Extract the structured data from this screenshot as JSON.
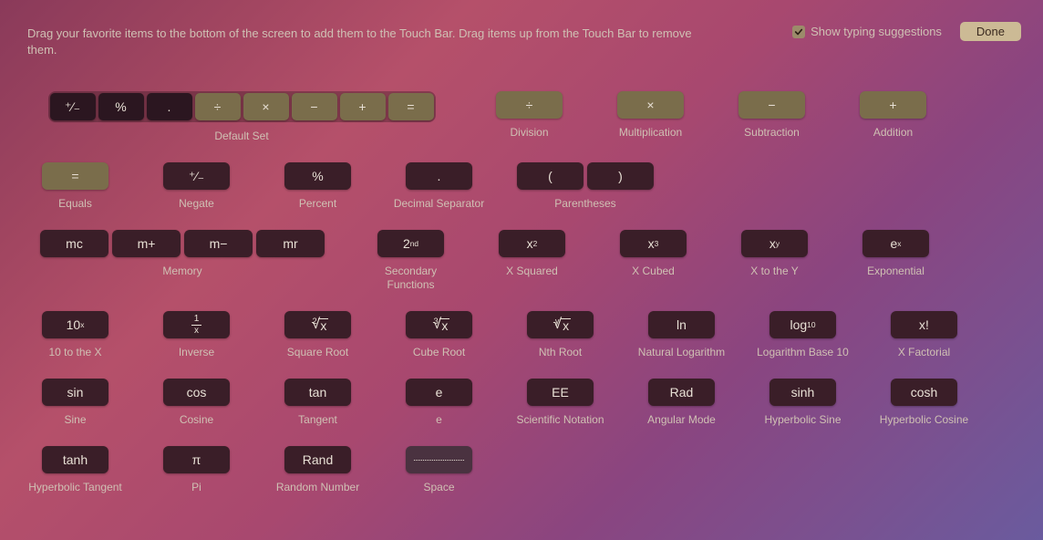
{
  "header": {
    "instructions": "Drag your favorite items to the bottom of the screen to add them to the Touch Bar. Drag items up from the Touch Bar to remove them.",
    "checkbox_label": "Show typing suggestions",
    "done_label": "Done"
  },
  "defaultSet": {
    "label": "Default Set",
    "keys": [
      "⁺⁄₋",
      "%",
      ".",
      "÷",
      "×",
      "−",
      "+",
      "="
    ]
  },
  "row1": {
    "division": {
      "glyph": "÷",
      "label": "Division"
    },
    "multiplication": {
      "glyph": "×",
      "label": "Multiplication"
    },
    "subtraction": {
      "glyph": "−",
      "label": "Subtraction"
    },
    "addition": {
      "glyph": "+",
      "label": "Addition"
    }
  },
  "row2": {
    "equals": {
      "glyph": "=",
      "label": "Equals"
    },
    "negate": {
      "glyph": "⁺⁄₋",
      "label": "Negate"
    },
    "percent": {
      "glyph": "%",
      "label": "Percent"
    },
    "decimal": {
      "glyph": ".",
      "label": "Decimal Separator"
    },
    "parens": {
      "open": "(",
      "close": ")",
      "label": "Parentheses"
    }
  },
  "row3": {
    "memory": {
      "keys": [
        "mc",
        "m+",
        "m−",
        "mr"
      ],
      "label": "Memory"
    },
    "secondary": {
      "base": "2",
      "sup": "nd",
      "label": "Secondary Functions"
    },
    "xsq": {
      "base": "x",
      "sup": "2",
      "label": "X Squared"
    },
    "xcb": {
      "base": "x",
      "sup": "3",
      "label": "X Cubed"
    },
    "xy": {
      "base": "x",
      "sup": "y",
      "label": "X to the Y"
    },
    "ex": {
      "base": "e",
      "sup": "x",
      "label": "Exponential"
    }
  },
  "row4": {
    "tenx": {
      "base": "10",
      "sup": "x",
      "label": "10 to the X"
    },
    "inverse": {
      "num": "1",
      "den": "x",
      "label": "Inverse"
    },
    "sqrt": {
      "index": "2",
      "radicand": "x",
      "label": "Square Root"
    },
    "cbrt": {
      "index": "3",
      "radicand": "x",
      "label": "Cube Root"
    },
    "nroot": {
      "index": "y",
      "radicand": "x",
      "label": "Nth Root"
    },
    "ln": {
      "glyph": "ln",
      "label": "Natural Logarithm"
    },
    "log10": {
      "base": "log",
      "sub": "10",
      "label": "Logarithm Base 10"
    },
    "xfact": {
      "glyph": "x!",
      "label": "X Factorial"
    }
  },
  "row5": {
    "sin": {
      "glyph": "sin",
      "label": "Sine"
    },
    "cos": {
      "glyph": "cos",
      "label": "Cosine"
    },
    "tan": {
      "glyph": "tan",
      "label": "Tangent"
    },
    "e": {
      "glyph": "e",
      "label": "e"
    },
    "ee": {
      "glyph": "EE",
      "label": "Scientific Notation"
    },
    "rad": {
      "glyph": "Rad",
      "label": "Angular Mode"
    },
    "sinh": {
      "glyph": "sinh",
      "label": "Hyperbolic Sine"
    },
    "cosh": {
      "glyph": "cosh",
      "label": "Hyperbolic Cosine"
    }
  },
  "row6": {
    "tanh": {
      "glyph": "tanh",
      "label": "Hyperbolic Tangent"
    },
    "pi": {
      "glyph": "π",
      "label": "Pi"
    },
    "rand": {
      "glyph": "Rand",
      "label": "Random Number"
    },
    "space": {
      "label": "Space"
    }
  }
}
